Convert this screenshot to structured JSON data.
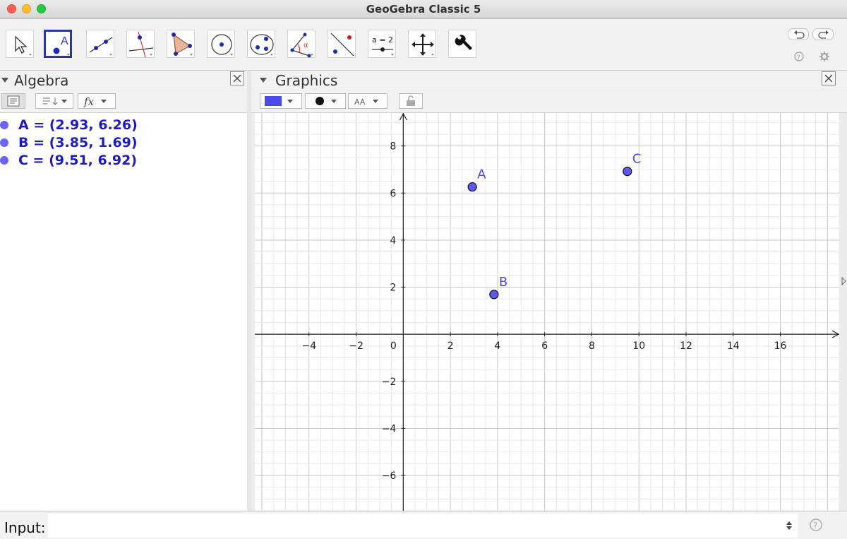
{
  "window": {
    "title": "GeoGebra Classic 5"
  },
  "toolbar": {
    "tools": [
      {
        "name": "move-tool"
      },
      {
        "name": "point-tool",
        "label": "A",
        "selected": true
      },
      {
        "name": "line-tool"
      },
      {
        "name": "perpendicular-line-tool"
      },
      {
        "name": "polygon-tool"
      },
      {
        "name": "circle-tool"
      },
      {
        "name": "conic-tool"
      },
      {
        "name": "angle-tool",
        "label": "α"
      },
      {
        "name": "reflect-tool"
      },
      {
        "name": "slider-tool",
        "label": "a = 2"
      },
      {
        "name": "move-graphics-view-tool"
      },
      {
        "name": "tools-settings-tool"
      }
    ]
  },
  "algebra": {
    "title": "Algebra",
    "items": [
      {
        "text": "A = (2.93, 6.26)",
        "color": "#6c63ff"
      },
      {
        "text": "B = (3.85, 1.69)",
        "color": "#6c63ff"
      },
      {
        "text": "C = (9.51, 6.92)",
        "color": "#6c63ff"
      }
    ]
  },
  "graphics": {
    "title": "Graphics",
    "style_bar": {
      "font_size_label": "AA",
      "point_color": "#4a4ae8"
    },
    "axes": {
      "x_ticks": [
        -4,
        -2,
        0,
        2,
        4,
        6,
        8,
        10,
        12,
        14,
        16
      ],
      "y_ticks": [
        8,
        6,
        4,
        2,
        -2,
        -4,
        -6
      ],
      "x_range": [
        -6.3,
        18.5
      ],
      "y_range": [
        -7.5,
        9.4
      ]
    },
    "points": [
      {
        "label": "A",
        "x": 2.93,
        "y": 6.26
      },
      {
        "label": "B",
        "x": 3.85,
        "y": 1.69
      },
      {
        "label": "C",
        "x": 9.51,
        "y": 6.92
      }
    ],
    "point_color": "#5a5af0",
    "label_color": "#4a4ae8"
  },
  "input": {
    "label": "Input:",
    "value": ""
  }
}
